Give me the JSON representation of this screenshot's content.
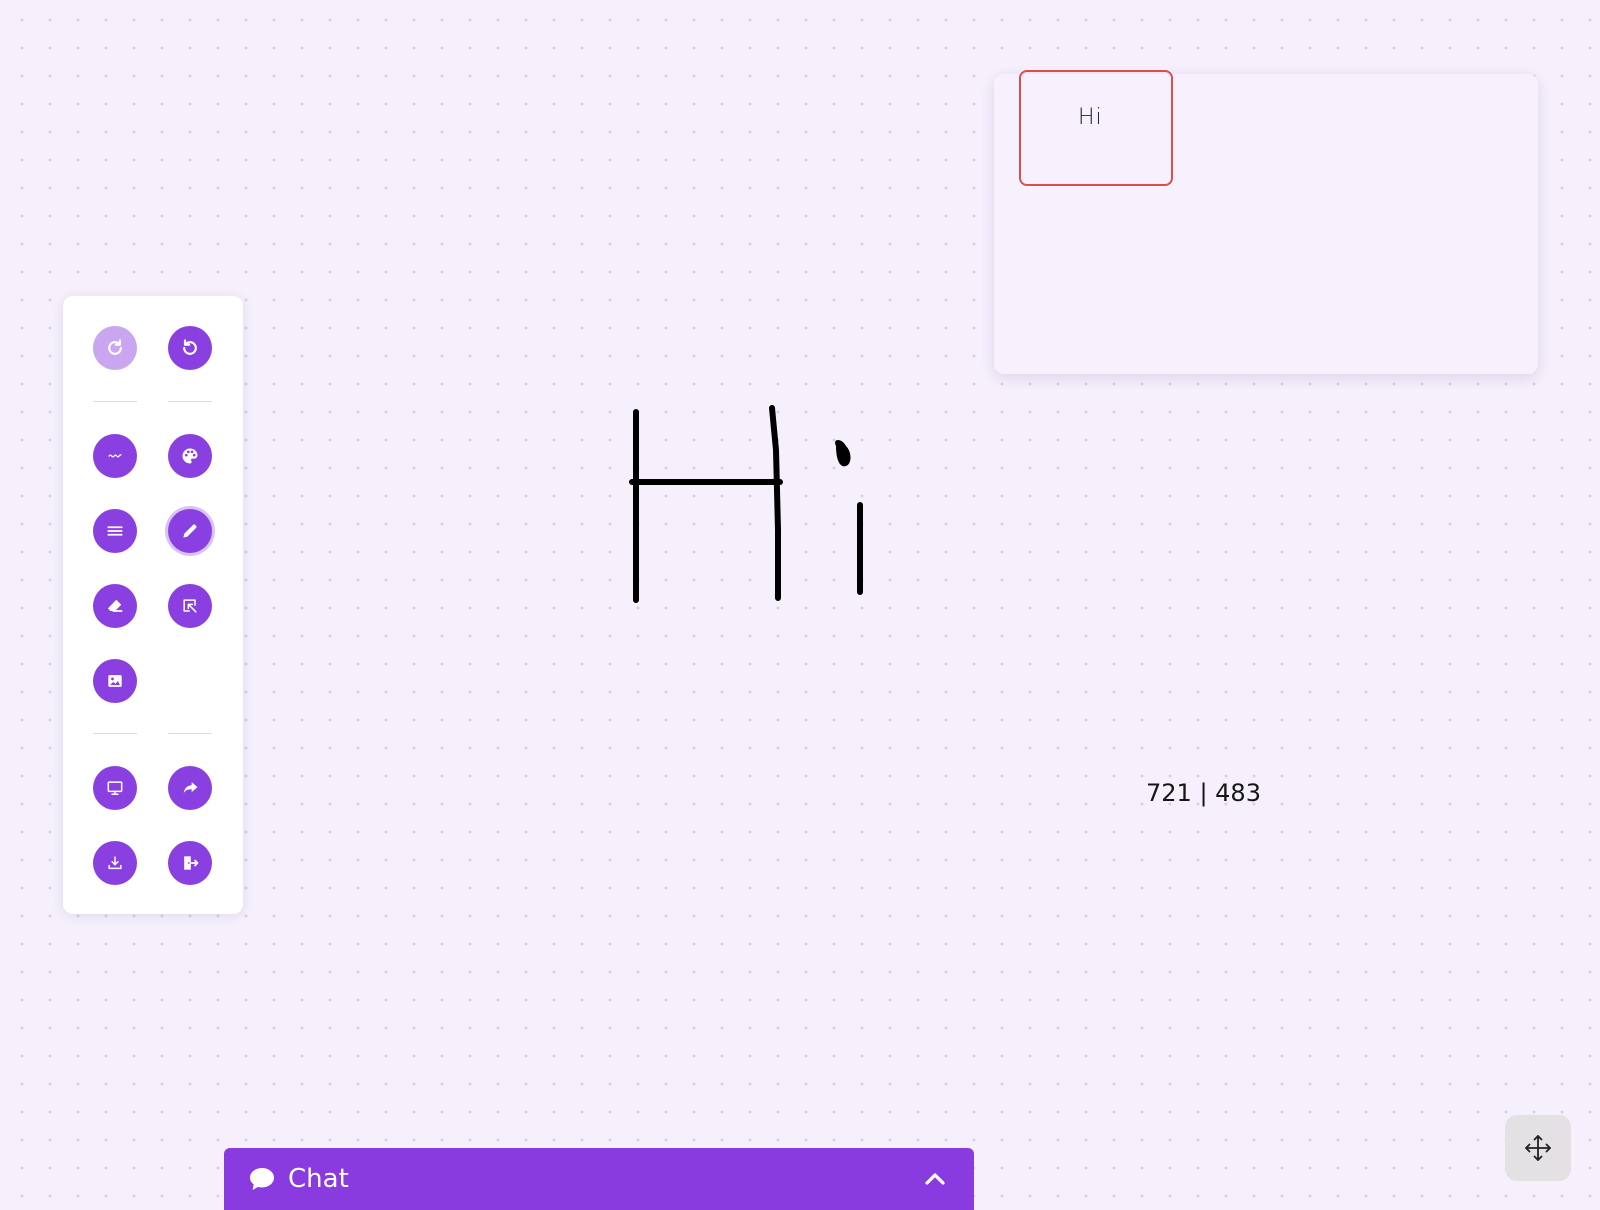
{
  "toolbar": {
    "tools": [
      {
        "name": "redo-button",
        "icon": "redo-icon",
        "state": "disabled"
      },
      {
        "name": "undo-button",
        "icon": "undo-icon",
        "state": "normal"
      },
      {
        "name": "stroke-style-button",
        "icon": "wave-icon",
        "state": "normal"
      },
      {
        "name": "color-palette-button",
        "icon": "palette-icon",
        "state": "normal"
      },
      {
        "name": "stroke-width-button",
        "icon": "lines-icon",
        "state": "normal"
      },
      {
        "name": "pencil-button",
        "icon": "pencil-icon",
        "state": "active"
      },
      {
        "name": "eraser-button",
        "icon": "eraser-icon",
        "state": "normal"
      },
      {
        "name": "select-button",
        "icon": "select-icon",
        "state": "normal"
      },
      {
        "name": "image-button",
        "icon": "image-icon",
        "state": "normal"
      },
      {
        "name": "present-button",
        "icon": "monitor-icon",
        "state": "normal"
      },
      {
        "name": "share-button",
        "icon": "share-icon",
        "state": "normal"
      },
      {
        "name": "download-button",
        "icon": "download-icon",
        "state": "normal"
      },
      {
        "name": "exit-button",
        "icon": "exit-door-icon",
        "state": "normal"
      }
    ]
  },
  "minimap": {
    "preview_text": "Hi"
  },
  "coordinates": {
    "text": "721 | 483"
  },
  "chat": {
    "label": "Chat",
    "icon": "speech-bubble-icon",
    "toggle_icon": "chevron-up-icon"
  },
  "move_control": {
    "icon": "move-arrows-icon"
  },
  "colors": {
    "accent": "#8a3fe0",
    "accent_disabled": "#c9a6ef",
    "canvas_background": "#f5f0fc",
    "viewport_border": "#dd4d4d",
    "ink": "#000000"
  }
}
